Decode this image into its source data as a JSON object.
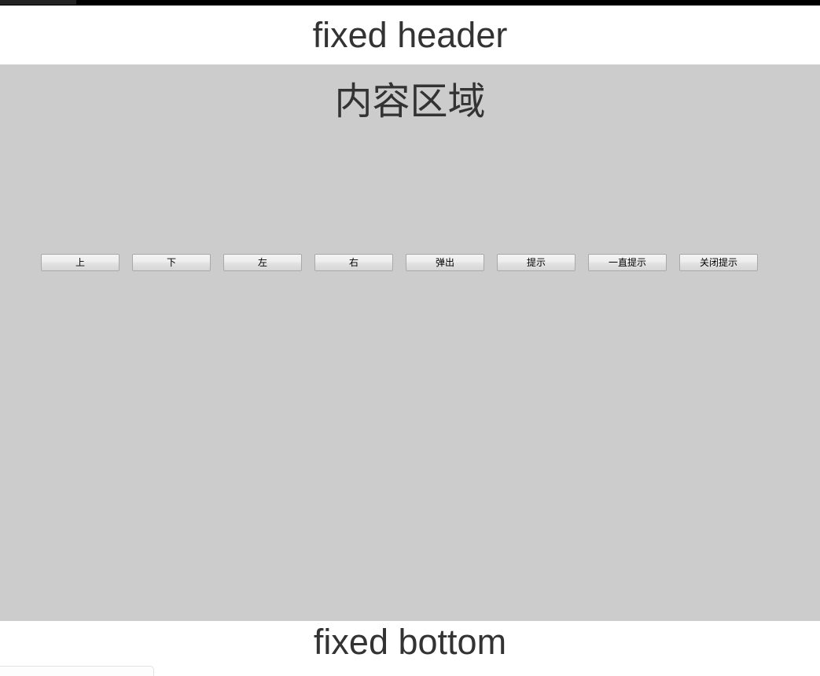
{
  "chrome": {
    "top_bar_color": "#000000",
    "tab_strip_color": "#222222"
  },
  "header": {
    "title": "fixed header",
    "background": "#ffffff",
    "text_color": "#333333"
  },
  "content": {
    "title": "内容区域",
    "background": "#cccccc",
    "text_color": "#333333",
    "buttons": [
      {
        "label": "上",
        "name": "up-button"
      },
      {
        "label": "下",
        "name": "down-button"
      },
      {
        "label": "左",
        "name": "left-button"
      },
      {
        "label": "右",
        "name": "right-button"
      },
      {
        "label": "弹出",
        "name": "popup-button"
      },
      {
        "label": "提示",
        "name": "toast-button"
      },
      {
        "label": "一直提示",
        "name": "persistent-toast-button"
      },
      {
        "label": "关闭提示",
        "name": "close-toast-button"
      }
    ]
  },
  "footer": {
    "title": "fixed bottom",
    "background": "#ffffff",
    "text_color": "#333333"
  },
  "status_bar": {
    "label": "",
    "background": "#fdfdfd",
    "border_color": "#e2e2e2"
  }
}
